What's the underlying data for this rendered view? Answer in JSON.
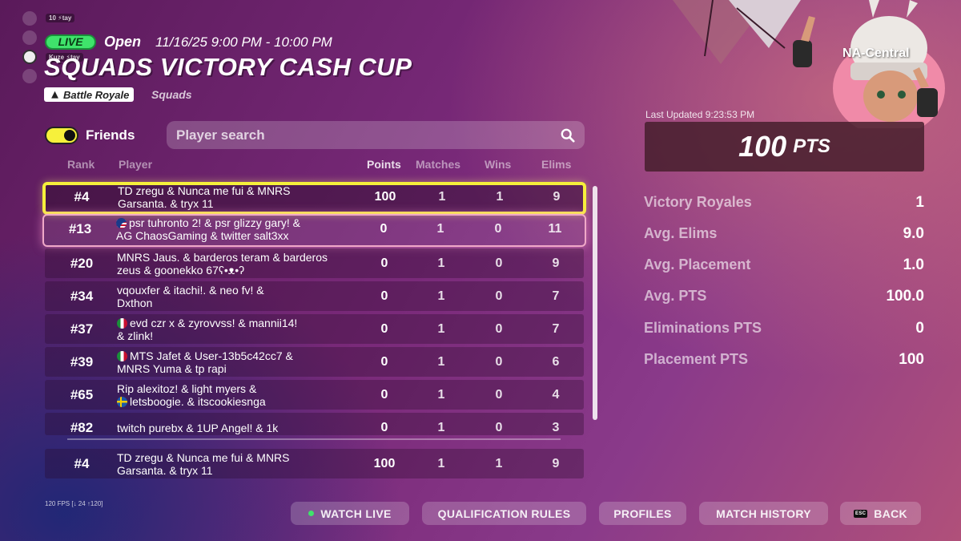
{
  "party": {
    "tags": [
      "10 ⚡tay",
      "Kuze ⚡tay"
    ]
  },
  "header": {
    "live_badge": "LIVE",
    "status": "Open",
    "datetime": "11/16/25 9:00 PM - 10:00 PM",
    "title": "SQUADS VICTORY CASH CUP",
    "mode": "Battle Royale",
    "sub_mode": "Squads"
  },
  "filters": {
    "friends_label": "Friends",
    "friends_on": true,
    "search_placeholder": "Player search"
  },
  "table": {
    "columns": [
      "Rank",
      "Player",
      "Points",
      "Matches",
      "Wins",
      "Elims"
    ],
    "rows": [
      {
        "rank": "#4",
        "player_line1": "TD zregu & Nunca me fui & MNRS",
        "player_line2": "Garsanta. & tryx 11",
        "points": "100",
        "matches": "1",
        "wins": "1",
        "elims": "9"
      },
      {
        "rank": "#13",
        "player_line1": "psr tuhronto 2! & psr glizzy gary! &",
        "player_line2": "AG ChaosGaming & twitter salt3xx",
        "points": "0",
        "matches": "1",
        "wins": "0",
        "elims": "11"
      },
      {
        "rank": "#20",
        "player_line1": "MNRS Jaus. & barderos teram & barderos",
        "player_line2": "zeus & goonekko 67ʕ•ᴥ•ʔ",
        "points": "0",
        "matches": "1",
        "wins": "0",
        "elims": "9"
      },
      {
        "rank": "#34",
        "player_line1": "vqouxfer & itachi!. & neo fv! &",
        "player_line2": "Dxthon",
        "points": "0",
        "matches": "1",
        "wins": "0",
        "elims": "7"
      },
      {
        "rank": "#37",
        "player_line1": "evd czr x & zyrovvss! & mannii14!",
        "player_line2": "& zlink!",
        "points": "0",
        "matches": "1",
        "wins": "0",
        "elims": "7"
      },
      {
        "rank": "#39",
        "player_line1": "MTS Jafet & User-13b5c42cc7 &",
        "player_line2": "MNRS Yuma & tp rapi",
        "points": "0",
        "matches": "1",
        "wins": "0",
        "elims": "6"
      },
      {
        "rank": "#65",
        "player_line1": "Rip alexitoz! & light myers &",
        "player_line2": "letsboogie. & itscookiesnga",
        "points": "0",
        "matches": "1",
        "wins": "0",
        "elims": "4"
      },
      {
        "rank": "#82",
        "player_line1": "twitch purebx & 1UP Angel! & 1k",
        "player_line2": "",
        "points": "0",
        "matches": "1",
        "wins": "0",
        "elims": "3"
      }
    ],
    "pinned_row": {
      "rank": "#4",
      "player_line1": "TD zregu & Nunca me fui & MNRS",
      "player_line2": "Garsanta. & tryx 11",
      "points": "100",
      "matches": "1",
      "wins": "1",
      "elims": "9"
    }
  },
  "panel": {
    "region": "NA-Central",
    "last_updated": "Last Updated 9:23:53 PM",
    "total_points": "100",
    "total_points_unit": "PTS",
    "stats": [
      {
        "label": "Victory Royales",
        "value": "1"
      },
      {
        "label": "Avg. Elims",
        "value": "9.0"
      },
      {
        "label": "Avg. Placement",
        "value": "1.0"
      },
      {
        "label": "Avg. PTS",
        "value": "100.0"
      },
      {
        "label": "Eliminations PTS",
        "value": "0"
      },
      {
        "label": "Placement PTS",
        "value": "100"
      }
    ]
  },
  "footer": {
    "fps": "120 FPS [↓ 24 ↑120]",
    "watch_live": "WATCH LIVE",
    "qualification_rules": "QUALIFICATION RULES",
    "profiles": "PROFILES",
    "match_history": "MATCH HISTORY",
    "esc_key": "ESC",
    "back": "BACK"
  },
  "colors": {
    "live_green": "#3fe36b",
    "highlight_yellow": "#f6f03b",
    "highlight_pink": "#f0a8c8"
  }
}
